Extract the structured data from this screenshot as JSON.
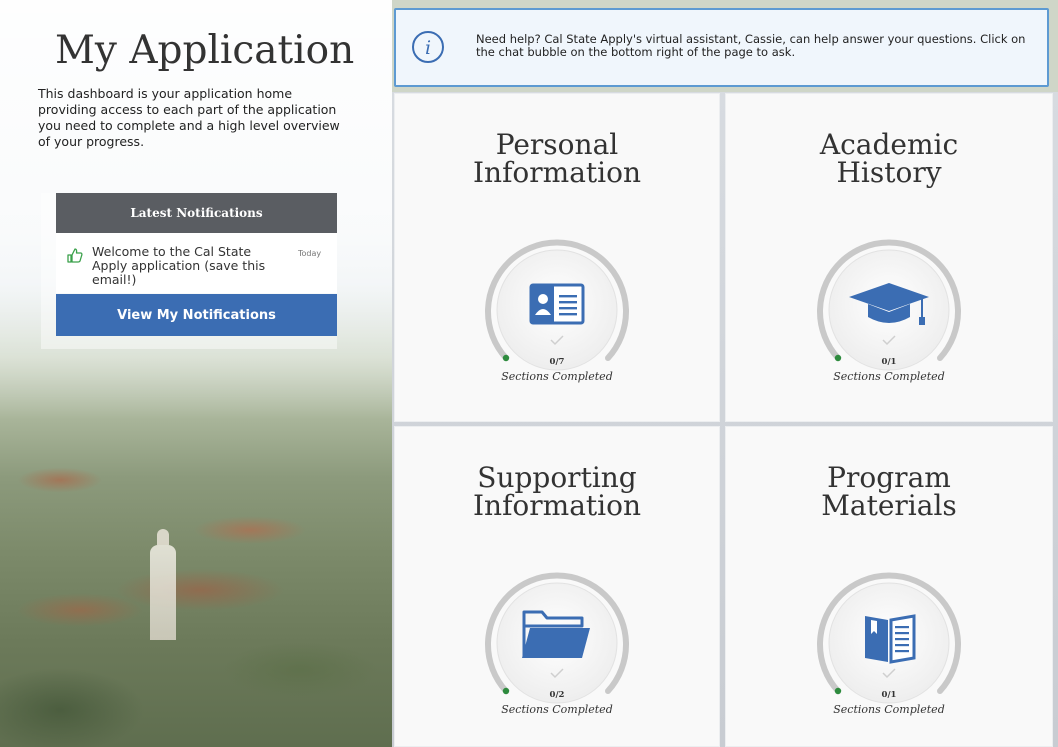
{
  "page": {
    "title": "My Application",
    "intro": "This dashboard is your application home providing access to each part of the application you need to complete and a high level overview of your progress."
  },
  "notifications": {
    "header": "Latest Notifications",
    "items": [
      {
        "message": "Welcome to the Cal State Apply application (save this email!)",
        "time": "Today"
      }
    ],
    "view_button": "View My Notifications"
  },
  "help": {
    "text": "Need help? Cal State Apply's virtual assistant, Cassie, can help answer your questions. Click on the chat bubble on the bottom right of the page to ask."
  },
  "sections": [
    {
      "title": "Personal Information",
      "icon": "id-card-icon",
      "count": "0/7",
      "caption": "Sections Completed"
    },
    {
      "title": "Academic History",
      "icon": "graduation-cap-icon",
      "count": "0/1",
      "caption": "Sections Completed"
    },
    {
      "title": "Supporting Information",
      "icon": "folder-icon",
      "count": "0/2",
      "caption": "Sections Completed"
    },
    {
      "title": "Program Materials",
      "icon": "book-icon",
      "count": "0/1",
      "caption": "Sections Completed"
    }
  ],
  "colors": {
    "accent_blue": "#3b6db3",
    "banner_border": "#5d9ad2",
    "progress_green": "#2e8b3e",
    "header_gray": "#5a5d62"
  }
}
